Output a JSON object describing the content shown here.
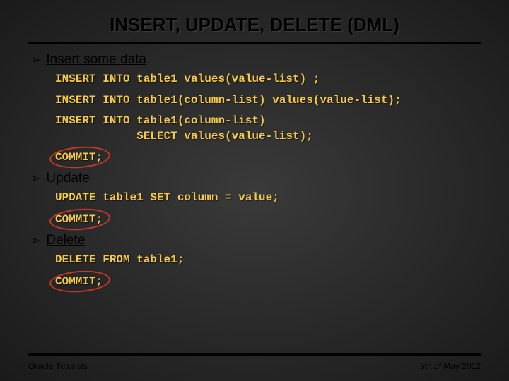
{
  "title": "INSERT, UPDATE, DELETE (DML)",
  "sections": {
    "insert": {
      "heading": "Insert some data",
      "code1": "INSERT INTO table1 values(value-list) ;",
      "code2": "INSERT INTO table1(column-list) values(value-list);",
      "code3": "INSERT INTO table1(column-list)\n            SELECT values(value-list);",
      "commit": "COMMIT;"
    },
    "update": {
      "heading": "Update",
      "code1": "UPDATE table1 SET column = value;",
      "commit": "COMMIT;"
    },
    "delete": {
      "heading": "Delete",
      "code1": "DELETE FROM table1;",
      "commit": "COMMIT;"
    }
  },
  "footer": {
    "left": "Oracle Tutorials",
    "right": "5th of May 2012"
  },
  "colors": {
    "code": "#f5c94a",
    "circle": "#c0392b",
    "background_center": "#3a3a3a",
    "background_edge": "#1a1a1a"
  }
}
